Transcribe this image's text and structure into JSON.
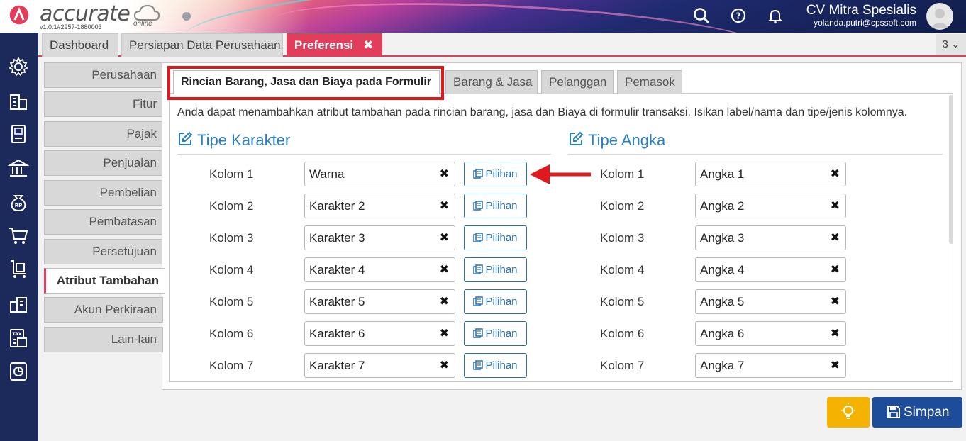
{
  "app": {
    "logo_text": "accurate",
    "logo_suffix": "online",
    "version": "v1.0.1#2957-1880003"
  },
  "header": {
    "company": "CV Mitra Spesialis",
    "email": "yolanda.putri@cpssoft.com",
    "icons": [
      "search-icon",
      "help-icon",
      "bell-icon",
      "avatar"
    ]
  },
  "tabs": [
    {
      "label": "Dashboard"
    },
    {
      "label": "Persiapan Data Perusahaan"
    },
    {
      "label": "Preferensi",
      "close": "✖"
    }
  ],
  "tab_counter": "3",
  "sidebar_icons": [
    "settings-icon",
    "building-icon",
    "book-icon",
    "bank-icon",
    "money-bag-icon",
    "cart-icon",
    "purchase-icon",
    "warehouse-icon",
    "tax-icon",
    "report-icon"
  ],
  "left_menu": [
    {
      "label": "Perusahaan"
    },
    {
      "label": "Fitur"
    },
    {
      "label": "Pajak"
    },
    {
      "label": "Penjualan"
    },
    {
      "label": "Pembelian"
    },
    {
      "label": "Pembatasan"
    },
    {
      "label": "Persetujuan"
    },
    {
      "label": "Atribut Tambahan"
    },
    {
      "label": "Akun Perkiraan"
    },
    {
      "label": "Lain-lain"
    }
  ],
  "subtabs": [
    {
      "label": "Rincian Barang, Jasa dan Biaya pada Formulir"
    },
    {
      "label": "Barang & Jasa"
    },
    {
      "label": "Pelanggan"
    },
    {
      "label": "Pemasok"
    }
  ],
  "description": "Anda dapat menambahkan atribut tambahan pada rincian barang, jasa dan Biaya di formulir transaksi. Isikan label/nama dan tipe/jenis kolomnya.",
  "karakter": {
    "title": "Tipe Karakter",
    "button_label": "Pilihan",
    "rows": [
      {
        "label": "Kolom 1",
        "value": "Warna"
      },
      {
        "label": "Kolom 2",
        "value": "Karakter 2"
      },
      {
        "label": "Kolom 3",
        "value": "Karakter 3"
      },
      {
        "label": "Kolom 4",
        "value": "Karakter 4"
      },
      {
        "label": "Kolom 5",
        "value": "Karakter 5"
      },
      {
        "label": "Kolom 6",
        "value": "Karakter 6"
      },
      {
        "label": "Kolom 7",
        "value": "Karakter 7"
      }
    ]
  },
  "angka": {
    "title": "Tipe Angka",
    "rows": [
      {
        "label": "Kolom 1",
        "value": "Angka 1"
      },
      {
        "label": "Kolom 2",
        "value": "Angka 2"
      },
      {
        "label": "Kolom 3",
        "value": "Angka 3"
      },
      {
        "label": "Kolom 4",
        "value": "Angka 4"
      },
      {
        "label": "Kolom 5",
        "value": "Angka 5"
      },
      {
        "label": "Kolom 6",
        "value": "Angka 6"
      },
      {
        "label": "Kolom 7",
        "value": "Angka 7"
      }
    ]
  },
  "clear_glyph": "✖",
  "footer": {
    "save_label": "Simpan"
  },
  "colors": {
    "accent": "#e23d5b",
    "sidebar": "#1b2a5a",
    "link_blue": "#2a7fc0",
    "save_button": "#1d4d9a",
    "bulb_button": "#f5b300",
    "annotation_red": "#e0191f"
  }
}
